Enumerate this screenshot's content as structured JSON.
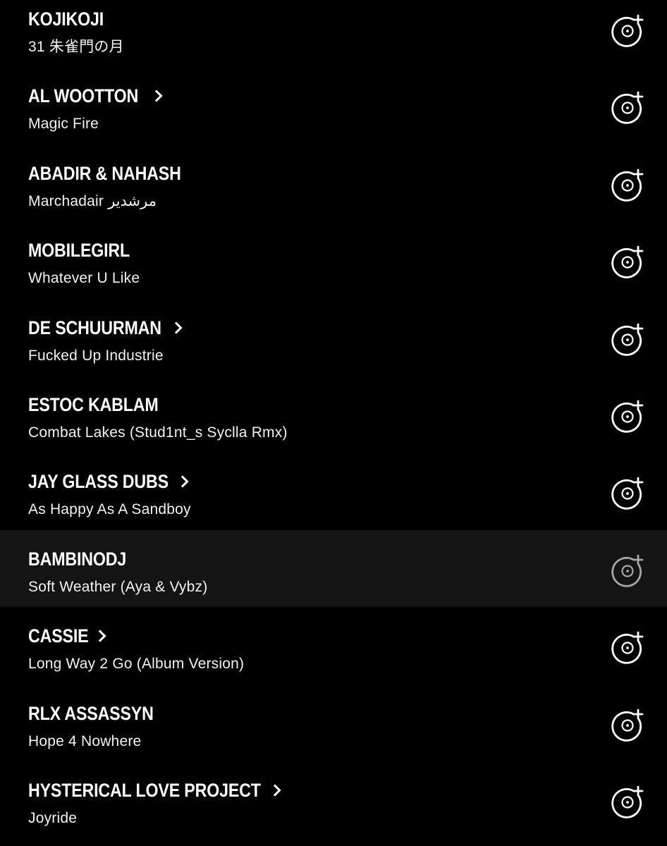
{
  "tracks": [
    {
      "artist": "KOJIKOJI",
      "title": "31 朱雀門の月",
      "has_chevron": false,
      "highlighted": false
    },
    {
      "artist": "AL WOOTTON",
      "title": "Magic Fire",
      "has_chevron": true,
      "highlighted": false
    },
    {
      "artist": "ABADIR & NAHASH",
      "title": "Marchadair مرشدير",
      "has_chevron": false,
      "highlighted": false
    },
    {
      "artist": "MOBILEGIRL",
      "title": "Whatever U Like",
      "has_chevron": false,
      "highlighted": false
    },
    {
      "artist": "DE SCHUURMAN",
      "title": "Fucked Up Industrie",
      "has_chevron": true,
      "highlighted": false
    },
    {
      "artist": "ESTOC KABLAM",
      "title": "Combat Lakes (Stud1nt_s Syclla Rmx)",
      "has_chevron": false,
      "highlighted": false
    },
    {
      "artist": "JAY GLASS DUBS",
      "title": "As Happy As A Sandboy",
      "has_chevron": true,
      "highlighted": false
    },
    {
      "artist": "BAMBINODJ",
      "title": "Soft Weather (Aya & Vybz)",
      "has_chevron": false,
      "highlighted": true
    },
    {
      "artist": "CASSIE",
      "title": "Long Way 2 Go (Album Version)",
      "has_chevron": true,
      "highlighted": false
    },
    {
      "artist": "RLX ASSASSYN",
      "title": "Hope 4 Nowhere",
      "has_chevron": false,
      "highlighted": false
    },
    {
      "artist": "HYSTERICAL LOVE PROJECT",
      "title": "Joyride",
      "has_chevron": true,
      "highlighted": false
    }
  ],
  "icons": {
    "row_action": "add-to-collection-disc-icon",
    "artist_link": "chevron-right-icon"
  },
  "colors": {
    "background": "#000000",
    "highlight_row": "#141414",
    "text": "#ffffff"
  }
}
